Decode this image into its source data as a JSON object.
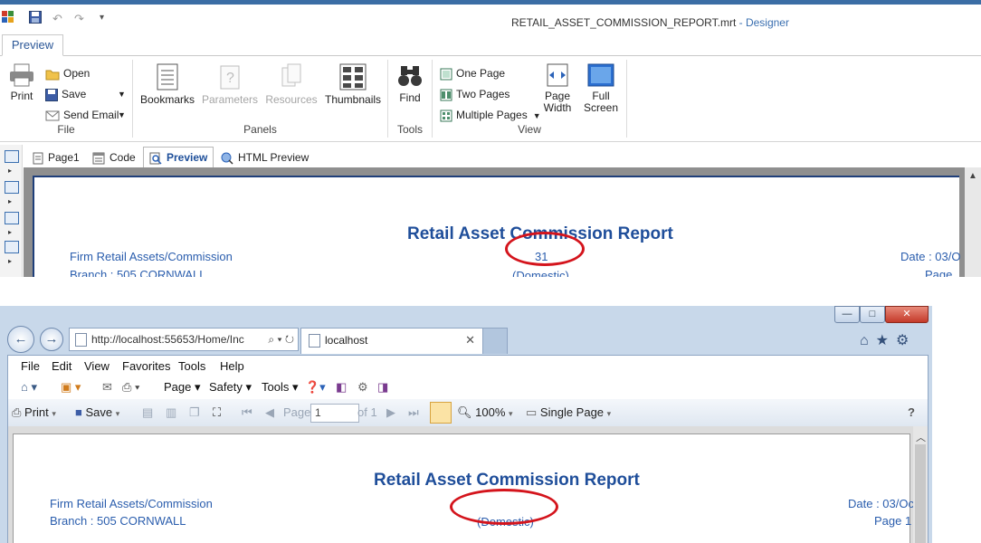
{
  "designer": {
    "title": "RETAIL_ASSET_COMMISSION_REPORT.mrt",
    "mode": " - Designer",
    "ribbon_tab": "Preview",
    "file_group": {
      "label": "File",
      "print": "Print",
      "open": "Open",
      "save": "Save",
      "send_email": "Send Email"
    },
    "panels_group": {
      "label": "Panels",
      "bookmarks": "Bookmarks",
      "parameters": "Parameters",
      "resources": "Resources",
      "thumbnails": "Thumbnails"
    },
    "tools_group": {
      "label": "Tools",
      "find": "Find"
    },
    "view_group": {
      "label": "View",
      "one_page": "One Page",
      "two_pages": "Two Pages",
      "multiple_pages": "Multiple Pages",
      "page_width_1": "Page",
      "page_width_2": "Width",
      "full_screen_1": "Full",
      "full_screen_2": "Screen"
    },
    "doc_tabs": [
      "Page1",
      "Code",
      "Preview",
      "HTML Preview"
    ],
    "report": {
      "title": "Retail Asset Commission Report",
      "left_line1": "Firm Retail Assets/Commission",
      "left_line2": "Branch : 505 CORNWALL",
      "center_value": "31",
      "center_line2": "(Domestic)",
      "right_line1": "Date : 03/O",
      "right_line2": "Page"
    }
  },
  "browser": {
    "window_controls": [
      "—",
      "□",
      "✕"
    ],
    "address": "http://localhost:55653/Home/Inc",
    "address_host": "localhost",
    "tab_title": "localhost",
    "menu": [
      "File",
      "Edit",
      "View",
      "Favorites",
      "Tools",
      "Help"
    ],
    "menu_underline": [
      "F",
      "E",
      "V",
      "a",
      "T",
      "H"
    ],
    "command_bar": {
      "page": "Page",
      "safety": "Safety",
      "tools": "Tools"
    },
    "viewer_toolbar": {
      "print": "Print",
      "save": "Save",
      "page_label": "Page",
      "page_value": "1",
      "of_label": "of 1",
      "zoom": "100%",
      "view_mode": "Single Page",
      "help": "?"
    },
    "report": {
      "title": "Retail Asset Commission Report",
      "left_line1": "Firm Retail Assets/Commission",
      "left_line2": "Branch : 505 CORNWALL",
      "center_line2": "(Domestic)",
      "right_line1": "Date : 03/Oc",
      "right_line2": "Page 1"
    }
  },
  "annotation_color": "#d4141c",
  "accent": "#1f4e9a"
}
